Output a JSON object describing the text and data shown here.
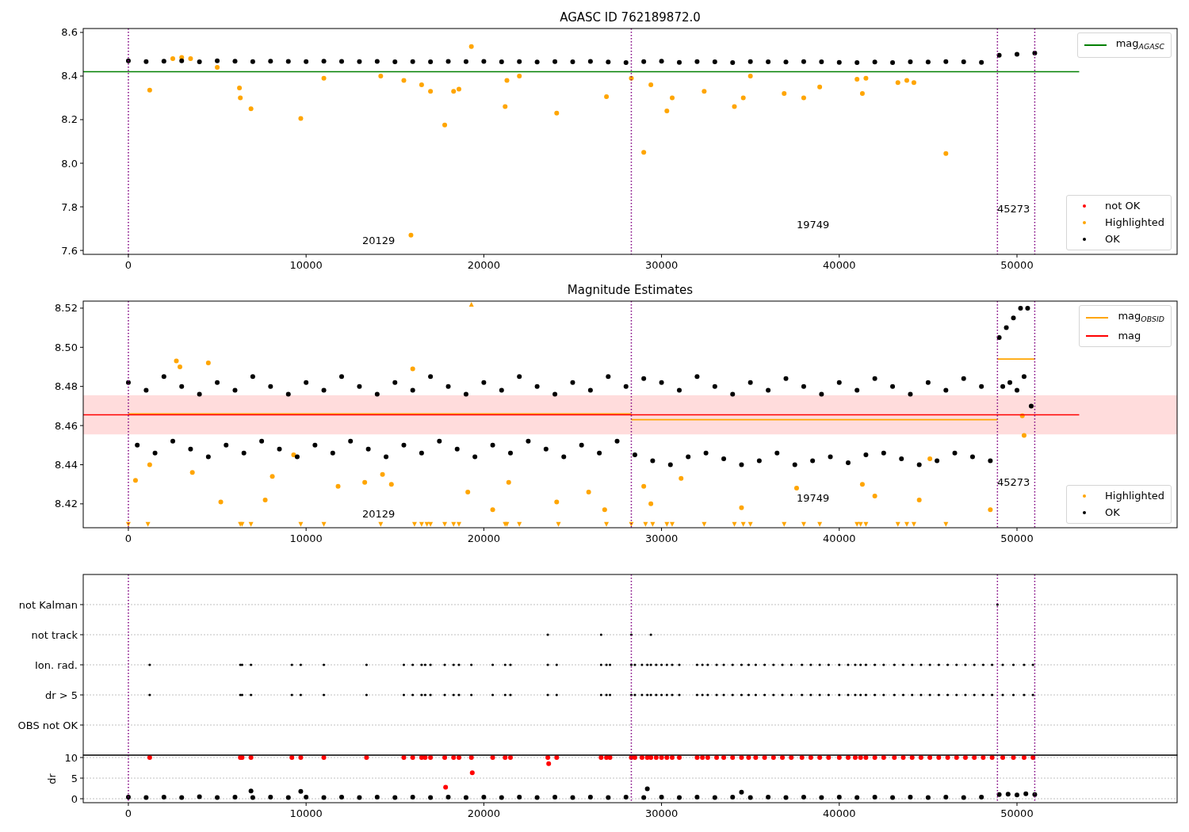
{
  "panels": [
    {
      "legend_extra": [
        {
          "label": "not OK",
          "color": "#ff0000"
        }
      ],
      "chart_data": {
        "type": "scatter",
        "title": "AGASC ID 762189872.0",
        "xlim": [
          -2540,
          59010
        ],
        "ylim": [
          7.582,
          8.618
        ],
        "xticks": [
          0,
          10000,
          20000,
          30000,
          40000,
          50000
        ],
        "yticks": [
          {
            "value": 7.6,
            "label": "7.6"
          },
          {
            "value": 7.8,
            "label": "7.8"
          },
          {
            "value": 8.0,
            "label": "8.0"
          },
          {
            "value": 8.2,
            "label": "8.2"
          },
          {
            "value": 8.4,
            "label": "8.4"
          },
          {
            "value": 8.6,
            "label": "8.6"
          }
        ],
        "series": [
          {
            "name": "mag$_{AGASC}$",
            "type": "line",
            "color": "#008000",
            "x": [
              -2540,
              53500
            ],
            "values": [
              8.42,
              8.42
            ]
          },
          {
            "name": "Highlighted",
            "color": "#ffa500",
            "x": [
              1200,
              2500,
              3000,
              3500,
              5000,
              6250,
              6300,
              6900,
              9700,
              11000,
              14200,
              15500,
              15900,
              16500,
              17000,
              17800,
              18300,
              18600,
              19300,
              21200,
              21300,
              22000,
              24100,
              26900,
              28300,
              29000,
              29400,
              30300,
              30600,
              32400,
              34100,
              34600,
              35000,
              36900,
              38000,
              38900,
              41000,
              41300,
              41500,
              43300,
              43800,
              44200,
              46000
            ],
            "values": [
              8.335,
              8.48,
              8.485,
              8.48,
              8.44,
              8.345,
              8.3,
              8.25,
              8.205,
              8.39,
              8.4,
              8.38,
              7.67,
              8.36,
              8.33,
              8.175,
              8.33,
              8.34,
              8.535,
              8.26,
              8.38,
              8.4,
              8.23,
              8.305,
              8.39,
              8.05,
              8.36,
              8.24,
              8.3,
              8.33,
              8.26,
              8.3,
              8.4,
              8.32,
              8.3,
              8.35,
              8.385,
              8.32,
              8.39,
              8.37,
              8.38,
              8.37,
              8.045
            ]
          },
          {
            "name": "OK",
            "color": "#000000",
            "x": [
              0,
              1000,
              2000,
              3000,
              4000,
              5000,
              6000,
              7000,
              8000,
              9000,
              10000,
              11000,
              12000,
              13000,
              14000,
              15000,
              16000,
              17000,
              18000,
              19000,
              20000,
              21000,
              22000,
              23000,
              24000,
              25000,
              26000,
              27000,
              28000,
              29000,
              30000,
              31000,
              32000,
              33000,
              34000,
              35000,
              36000,
              37000,
              38000,
              39000,
              40000,
              41000,
              42000,
              43000,
              44000,
              45000,
              46000,
              47000,
              48000,
              49000,
              50000,
              51000
            ],
            "values": [
              8.47,
              8.466,
              8.468,
              8.47,
              8.465,
              8.47,
              8.468,
              8.466,
              8.468,
              8.467,
              8.466,
              8.468,
              8.467,
              8.466,
              8.467,
              8.465,
              8.466,
              8.465,
              8.467,
              8.466,
              8.467,
              8.465,
              8.466,
              8.464,
              8.466,
              8.465,
              8.467,
              8.464,
              8.462,
              8.466,
              8.468,
              8.463,
              8.466,
              8.465,
              8.462,
              8.466,
              8.465,
              8.464,
              8.466,
              8.465,
              8.463,
              8.462,
              8.464,
              8.462,
              8.465,
              8.464,
              8.466,
              8.465,
              8.463,
              8.495,
              8.5,
              8.505
            ]
          }
        ],
        "ref_lines": [
          {
            "axis": "x",
            "value": 0,
            "color": "#800080"
          },
          {
            "axis": "x",
            "value": 28300,
            "color": "#800080"
          },
          {
            "axis": "x",
            "value": 48900,
            "color": "#800080"
          },
          {
            "axis": "x",
            "value": 51000,
            "color": "#800080"
          }
        ],
        "annotations": [
          "20129",
          "19749",
          "45273"
        ]
      }
    },
    {
      "chart_data": {
        "type": "scatter",
        "title": "Magnitude Estimates",
        "xlim": [
          -2540,
          59010
        ],
        "ylim": [
          8.4078,
          8.5236
        ],
        "xticks": [
          0,
          10000,
          20000,
          30000,
          40000,
          50000
        ],
        "yticks": [
          {
            "value": 8.42,
            "label": "8.42"
          },
          {
            "value": 8.44,
            "label": "8.44"
          },
          {
            "value": 8.46,
            "label": "8.46"
          },
          {
            "value": 8.48,
            "label": "8.48"
          },
          {
            "value": 8.5,
            "label": "8.50"
          },
          {
            "value": 8.52,
            "label": "8.52"
          }
        ],
        "series": [
          {
            "name": "mag$_{OBSID}$",
            "type": "line",
            "color": "#ffa500",
            "x": [
              0,
              28300,
              null,
              28300,
              48900,
              null,
              48900,
              51000
            ],
            "values": [
              8.466,
              8.466,
              null,
              8.463,
              8.463,
              null,
              8.494,
              8.494
            ]
          },
          {
            "name": "mag",
            "type": "line",
            "color": "#ff0000",
            "x": [
              -2540,
              53500
            ],
            "values": [
              8.4655,
              8.4655
            ]
          },
          {
            "name": "Highlighted",
            "color": "#ffa500",
            "x": [
              0,
              400,
              1100,
              1200,
              2700,
              2900,
              3600,
              4500,
              5200,
              6300,
              6400,
              6900,
              7700,
              8100,
              9300,
              9700,
              11000,
              11800,
              13300,
              14200,
              14300,
              14800,
              16000,
              16100,
              16500,
              16800,
              17000,
              17800,
              18300,
              18600,
              19100,
              19300,
              20500,
              21200,
              21300,
              21400,
              22000,
              24100,
              24200,
              25900,
              26800,
              26900,
              28300,
              29000,
              29100,
              29400,
              29500,
              30300,
              30600,
              31100,
              32400,
              34100,
              34500,
              34600,
              35000,
              36900,
              37600,
              38000,
              38900,
              41000,
              41200,
              41300,
              41500,
              42000,
              43300,
              43800,
              44200,
              44500,
              45100,
              46000,
              48500,
              50300,
              50400
            ],
            "values": [
              8.4095,
              8.432,
              8.4095,
              8.44,
              8.493,
              8.49,
              8.436,
              8.492,
              8.421,
              8.4095,
              8.4095,
              8.4095,
              8.422,
              8.434,
              8.445,
              8.4095,
              8.4095,
              8.429,
              8.431,
              8.4095,
              8.435,
              8.43,
              8.489,
              8.4095,
              8.4095,
              8.4095,
              8.4095,
              8.4095,
              8.4095,
              8.4095,
              8.426,
              8.522,
              8.417,
              8.4095,
              8.4095,
              8.431,
              8.4095,
              8.421,
              8.4095,
              8.426,
              8.417,
              8.4095,
              8.4095,
              8.429,
              8.4095,
              8.42,
              8.4095,
              8.4095,
              8.4095,
              8.433,
              8.4095,
              8.4095,
              8.418,
              8.4095,
              8.4095,
              8.4095,
              8.428,
              8.4095,
              8.4095,
              8.4095,
              8.4095,
              8.43,
              8.4095,
              8.424,
              8.4095,
              8.4095,
              8.4095,
              8.422,
              8.443,
              8.4095,
              8.417,
              8.465,
              8.455
            ]
          },
          {
            "name": "OK",
            "color": "#000000",
            "x": [
              0,
              500,
              1000,
              1500,
              2000,
              2500,
              3000,
              3500,
              4000,
              4500,
              5000,
              5500,
              6000,
              6500,
              7000,
              7500,
              8000,
              8500,
              9000,
              9500,
              10000,
              10500,
              11000,
              11500,
              12000,
              12500,
              13000,
              13500,
              14000,
              14500,
              15000,
              15500,
              16000,
              16500,
              17000,
              17500,
              18000,
              18500,
              19000,
              19500,
              20000,
              20500,
              21000,
              21500,
              22000,
              22500,
              23000,
              23500,
              24000,
              24500,
              25000,
              25500,
              26000,
              26500,
              27000,
              27500,
              28000,
              28500,
              29000,
              29500,
              30000,
              30500,
              31000,
              31500,
              32000,
              32500,
              33000,
              33500,
              34000,
              34500,
              35000,
              35500,
              36000,
              36500,
              37000,
              37500,
              38000,
              38500,
              39000,
              39500,
              40000,
              40500,
              41000,
              41500,
              42000,
              42500,
              43000,
              43500,
              44000,
              44500,
              45000,
              45500,
              46000,
              46500,
              47000,
              47500,
              48000,
              48500,
              49000,
              49200,
              49400,
              49600,
              49800,
              50000,
              50200,
              50400,
              50600,
              50800
            ],
            "values": [
              8.482,
              8.45,
              8.478,
              8.446,
              8.485,
              8.452,
              8.48,
              8.448,
              8.476,
              8.444,
              8.482,
              8.45,
              8.478,
              8.446,
              8.485,
              8.452,
              8.48,
              8.448,
              8.476,
              8.444,
              8.482,
              8.45,
              8.478,
              8.446,
              8.485,
              8.452,
              8.48,
              8.448,
              8.476,
              8.444,
              8.482,
              8.45,
              8.478,
              8.446,
              8.485,
              8.452,
              8.48,
              8.448,
              8.476,
              8.444,
              8.482,
              8.45,
              8.478,
              8.446,
              8.485,
              8.452,
              8.48,
              8.448,
              8.476,
              8.444,
              8.482,
              8.45,
              8.478,
              8.446,
              8.485,
              8.452,
              8.48,
              8.445,
              8.484,
              8.442,
              8.482,
              8.44,
              8.478,
              8.444,
              8.485,
              8.446,
              8.48,
              8.443,
              8.476,
              8.44,
              8.482,
              8.442,
              8.478,
              8.446,
              8.484,
              8.44,
              8.48,
              8.442,
              8.476,
              8.444,
              8.482,
              8.441,
              8.478,
              8.445,
              8.484,
              8.446,
              8.48,
              8.443,
              8.476,
              8.44,
              8.482,
              8.442,
              8.478,
              8.446,
              8.484,
              8.444,
              8.48,
              8.442,
              8.505,
              8.48,
              8.51,
              8.482,
              8.515,
              8.478,
              8.52,
              8.485,
              8.52,
              8.47
            ]
          }
        ],
        "bands": [
          {
            "axis": "y",
            "from": 8.4555,
            "to": 8.4755,
            "color": "#ffdcdc"
          }
        ],
        "ref_lines": [
          {
            "axis": "x",
            "value": 0,
            "color": "#800080"
          },
          {
            "axis": "x",
            "value": 28300,
            "color": "#800080"
          },
          {
            "axis": "x",
            "value": 48900,
            "color": "#800080"
          },
          {
            "axis": "x",
            "value": 51000,
            "color": "#800080"
          }
        ],
        "annotations": [
          "20129",
          "19749",
          "45273"
        ]
      }
    },
    {
      "flag_labels": [
        "not Kalman",
        "not track",
        "Ion. rad.",
        "dr > 5",
        "OBS not OK"
      ]
    },
    {
      "chart_data": {
        "type": "scatter",
        "grid": true,
        "ylabel": "dr",
        "xlim": [
          -2540,
          59010
        ],
        "ylim": [
          -0.96,
          10.58
        ],
        "xticks": [
          0,
          10000,
          20000,
          30000,
          40000,
          50000
        ],
        "yticks": [
          0,
          5,
          10
        ],
        "series": [
          {
            "color": "#ff0000",
            "x": [
              1200,
              6300,
              6400,
              6900,
              9200,
              9700,
              11000,
              13400,
              15500,
              16000,
              16500,
              16700,
              17000,
              17800,
              17850,
              18300,
              18600,
              19300,
              19350,
              20500,
              21200,
              21500,
              23600,
              23650,
              24100,
              26600,
              26900,
              27100,
              28300,
              28500,
              28900,
              29200,
              29400,
              29700,
              30000,
              30300,
              30600,
              31000,
              32000,
              32300,
              32600,
              33100,
              33500,
              34000,
              34500,
              34900,
              35300,
              35800,
              36300,
              36800,
              37300,
              37900,
              38400,
              38900,
              39400,
              40000,
              40500,
              40900,
              41200,
              41500,
              42000,
              42500,
              43100,
              43600,
              44100,
              44600,
              45100,
              45600,
              46100,
              46600,
              47100,
              47600,
              48100,
              48600,
              49200,
              49800,
              50400,
              50900
            ],
            "values": [
              10,
              10,
              10,
              10,
              10,
              10,
              10,
              10,
              10,
              10,
              10,
              10,
              10,
              10,
              2.8,
              10,
              10,
              10,
              6.3,
              10,
              10,
              10,
              10,
              8.5,
              10,
              10,
              10,
              10,
              10,
              10,
              10,
              10,
              10,
              10,
              10,
              10,
              10,
              10,
              10,
              10,
              10,
              10,
              10,
              10,
              10,
              10,
              10,
              10,
              10,
              10,
              10,
              10,
              10,
              10,
              10,
              10,
              10,
              10,
              10,
              10,
              10,
              10,
              10,
              10,
              10,
              10,
              10,
              10,
              10,
              10,
              10,
              10,
              10,
              10,
              10,
              10,
              10,
              10
            ]
          },
          {
            "color": "#000000",
            "x": [
              0,
              1000,
              2000,
              3000,
              4000,
              5000,
              6000,
              6900,
              7000,
              8000,
              9000,
              9700,
              10000,
              11000,
              12000,
              13000,
              14000,
              15000,
              16000,
              17000,
              18000,
              19000,
              20000,
              21000,
              22000,
              23000,
              24000,
              25000,
              26000,
              27000,
              28000,
              29000,
              29200,
              30000,
              31000,
              32000,
              33000,
              34000,
              34500,
              35000,
              36000,
              37000,
              38000,
              39000,
              40000,
              41000,
              42000,
              43000,
              44000,
              45000,
              46000,
              47000,
              48000,
              49000,
              49500,
              50000,
              50500,
              51000
            ],
            "values": [
              0.4,
              0.3,
              0.4,
              0.3,
              0.5,
              0.3,
              0.4,
              1.9,
              0.3,
              0.4,
              0.3,
              1.8,
              0.4,
              0.3,
              0.4,
              0.3,
              0.4,
              0.3,
              0.4,
              0.3,
              0.4,
              0.3,
              0.4,
              0.3,
              0.4,
              0.3,
              0.4,
              0.3,
              0.4,
              0.3,
              0.4,
              0.3,
              2.4,
              0.4,
              0.3,
              0.4,
              0.3,
              0.4,
              1.6,
              0.3,
              0.4,
              0.3,
              0.4,
              0.3,
              0.4,
              0.3,
              0.4,
              0.3,
              0.4,
              0.3,
              0.4,
              0.3,
              0.4,
              1.0,
              1.1,
              0.9,
              1.2,
              1.0
            ]
          }
        ],
        "ref_lines": [
          {
            "axis": "x",
            "value": 0,
            "color": "#800080"
          },
          {
            "axis": "x",
            "value": 28300,
            "color": "#800080"
          },
          {
            "axis": "x",
            "value": 48900,
            "color": "#800080"
          },
          {
            "axis": "x",
            "value": 51000,
            "color": "#800080"
          }
        ]
      }
    }
  ]
}
